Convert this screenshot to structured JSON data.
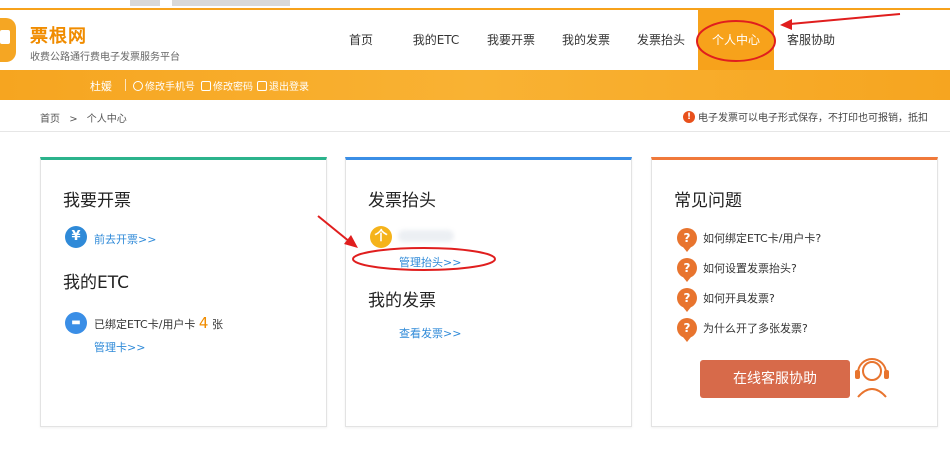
{
  "brand": {
    "name": "票根网",
    "tagline": "收费公路通行费电子发票服务平台"
  },
  "nav": {
    "items": [
      {
        "label": "首页"
      },
      {
        "label": "我的ETC"
      },
      {
        "label": "我要开票"
      },
      {
        "label": "我的发票"
      },
      {
        "label": "发票抬头"
      },
      {
        "label": "个人中心",
        "active": true
      },
      {
        "label": "客服协助"
      }
    ]
  },
  "subbar": {
    "username": "杜媛",
    "actions": [
      {
        "label": "修改手机号",
        "icon": "face-icon"
      },
      {
        "label": "修改密码",
        "icon": "lock-icon"
      },
      {
        "label": "退出登录",
        "icon": "logout-icon"
      }
    ]
  },
  "breadcrumb": {
    "home": "首页",
    "separator": ">",
    "current": "个人中心"
  },
  "notice": "电子发票可以电子形式保存，不打印也可报销，抵扣",
  "cards": {
    "invoice": {
      "title": "我要开票",
      "link": "前去开票>>",
      "etc_title": "我的ETC",
      "etc_text_prefix": "已绑定ETC卡/用户卡",
      "etc_count": "4",
      "etc_text_suffix": "张",
      "etc_link": "管理卡>>"
    },
    "header": {
      "title": "发票抬头",
      "avatar_char": "个",
      "manage_link": "管理抬头>>",
      "my_invoice_title": "我的发票",
      "view_link": "查看发票>>"
    },
    "faq": {
      "title": "常见问题",
      "items": [
        "如何绑定ETC卡/用户卡?",
        "如何设置发票抬头?",
        "如何开具发票?",
        "为什么开了多张发票?"
      ],
      "service_button": "在线客服协助"
    }
  },
  "colors": {
    "accent_orange": "#f7a21b",
    "green": "#2bb38c",
    "blue": "#3a8ee6",
    "orange_red": "#f0793a",
    "link_blue": "#2f8ad8",
    "annotation_red": "#e01e1e"
  }
}
